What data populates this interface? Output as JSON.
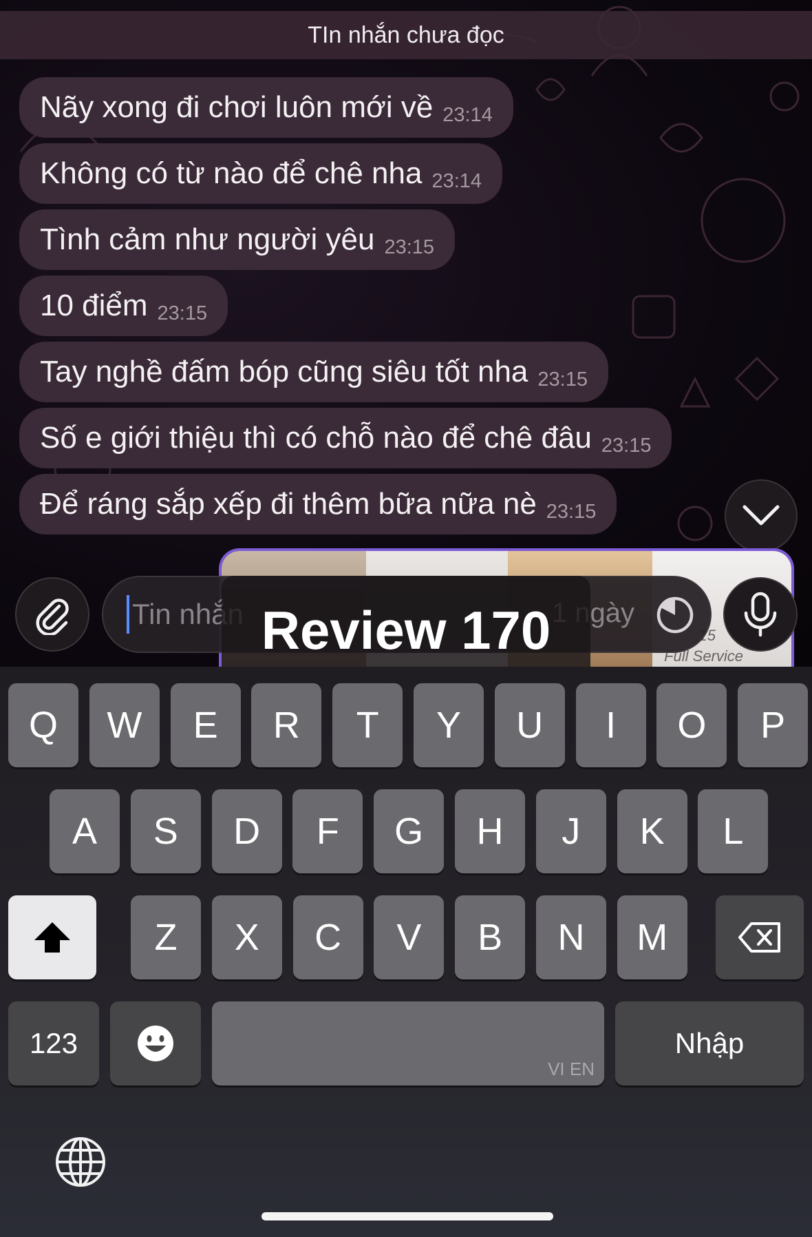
{
  "banner": {
    "text": "TIn nhắn chưa đọc"
  },
  "messages": [
    {
      "text": "Nãy xong đi chơi luôn mới về",
      "time": "23:14"
    },
    {
      "text": "Không có từ nào để chê nha",
      "time": "23:14"
    },
    {
      "text": "Tình cảm như người yêu",
      "time": "23:15"
    },
    {
      "text": "10 điểm",
      "time": "23:15"
    },
    {
      "text": "Tay nghề đấm bóp cũng siêu tốt nha",
      "time": "23:15"
    },
    {
      "text": "Số e giới thiệu thì có chỗ nào để chê đâu",
      "time": "23:15"
    },
    {
      "text": "Để ráng sắp xếp đi thêm bữa nữa nè",
      "time": "23:15"
    }
  ],
  "media_preview": {
    "time": ":15",
    "caption": "Full Service"
  },
  "composer": {
    "placeholder": "Tin nhắn",
    "timer_text": "1 ngày"
  },
  "overlay": {
    "text": "Review 170"
  },
  "keyboard": {
    "row1": [
      "Q",
      "W",
      "E",
      "R",
      "T",
      "Y",
      "U",
      "I",
      "O",
      "P"
    ],
    "row2": [
      "A",
      "S",
      "D",
      "F",
      "G",
      "H",
      "J",
      "K",
      "L"
    ],
    "row3": [
      "Z",
      "X",
      "C",
      "V",
      "B",
      "N",
      "M"
    ],
    "numbers_label": "123",
    "return_label": "Nhập",
    "space_languages": "VI EN"
  },
  "icons": {
    "attach": "paperclip-icon",
    "timer": "timer-icon",
    "mic": "microphone-icon",
    "scroll": "chevron-down-icon",
    "shift": "shift-arrow-icon",
    "backspace": "backspace-icon",
    "emoji": "emoji-icon",
    "globe": "globe-icon"
  },
  "colors": {
    "bubble": "#3b2a37",
    "accent": "#7c5bd6",
    "caret": "#5a8cff"
  }
}
